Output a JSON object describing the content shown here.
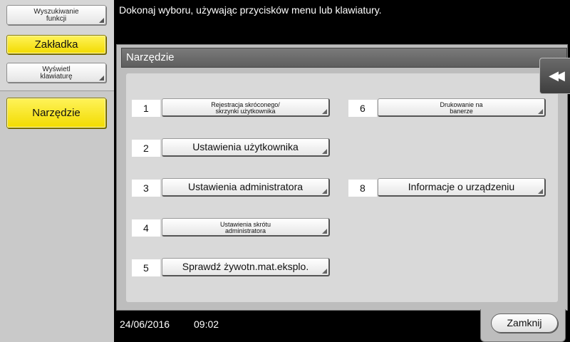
{
  "sidebar": {
    "search_functions": [
      "Wyszukiwanie",
      "funkcji"
    ],
    "bookmark": "Zakładka",
    "show_keypad": [
      "Wyświetl",
      "klawiaturę"
    ],
    "utility": "Narzędzie"
  },
  "header": {
    "message": "Dokonaj wyboru, używając przycisków menu lub klawiatury."
  },
  "panel": {
    "title": "Narzędzie",
    "items": [
      {
        "num": "1",
        "label_lines": [
          "Rejestracja skróconego/",
          "skrzynki użytkownika"
        ]
      },
      {
        "num": "2",
        "label": "Ustawienia użytkownika"
      },
      {
        "num": "3",
        "label": "Ustawienia administratora"
      },
      {
        "num": "4",
        "label_lines": [
          "Ustawienia skrótu",
          "administratora"
        ]
      },
      {
        "num": "5",
        "label": "Sprawdź żywotn.mat.eksplo."
      },
      {
        "num": "6",
        "label_lines": [
          "Drukowanie na",
          "banerze"
        ]
      },
      {
        "num": "8",
        "label": "Informacje o urządzeniu"
      }
    ]
  },
  "footer": {
    "date": "24/06/2016",
    "time": "09:02",
    "close_label": "Zamknij"
  },
  "icons": {
    "collapse": "double-left-arrow-icon",
    "collapse_glyph": "◀◀"
  },
  "colors": {
    "highlight": "#f2db00",
    "background": "#000000",
    "panel": "#bdbdbd"
  }
}
